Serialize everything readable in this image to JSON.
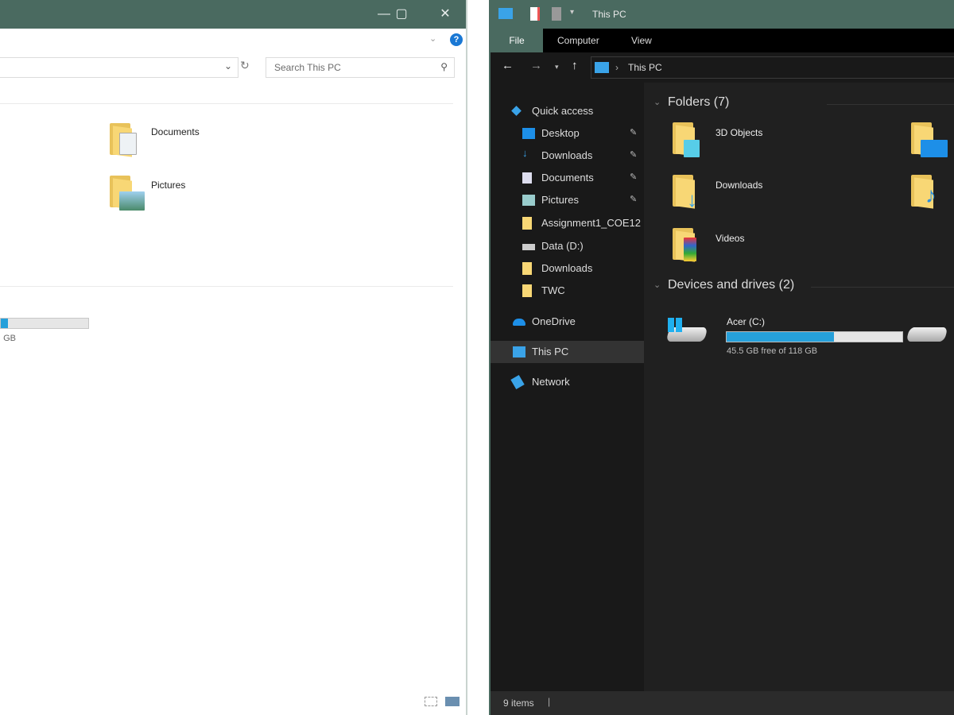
{
  "left_window": {
    "controls": {
      "minimize": "—",
      "maximize": "▢",
      "close": "✕"
    },
    "search_placeholder": "Search This PC",
    "folders": [
      {
        "label": "Documents",
        "icon": "documents-folder-icon"
      },
      {
        "label": "Pictures",
        "icon": "pictures-folder-icon"
      }
    ],
    "drive": {
      "size_text": "GB",
      "used_fraction": 0.08
    },
    "help": "?"
  },
  "right_window": {
    "title": "This PC",
    "tabs": [
      "File",
      "Computer",
      "View"
    ],
    "address": "This PC",
    "sidebar": [
      {
        "label": "Quick access",
        "icon": "star-icon",
        "pinned": false,
        "indent": 0
      },
      {
        "label": "Desktop",
        "icon": "desktop-icon",
        "pinned": true,
        "indent": 1
      },
      {
        "label": "Downloads",
        "icon": "download-icon",
        "pinned": true,
        "indent": 1
      },
      {
        "label": "Documents",
        "icon": "document-icon",
        "pinned": true,
        "indent": 1
      },
      {
        "label": "Pictures",
        "icon": "pictures-icon",
        "pinned": true,
        "indent": 1
      },
      {
        "label": "Assignment1_COE12",
        "icon": "folder-icon",
        "pinned": false,
        "indent": 1
      },
      {
        "label": "Data (D:)",
        "icon": "drive-icon",
        "pinned": false,
        "indent": 1
      },
      {
        "label": "Downloads",
        "icon": "folder-icon",
        "pinned": false,
        "indent": 1
      },
      {
        "label": "TWC",
        "icon": "folder-icon",
        "pinned": false,
        "indent": 1
      },
      {
        "label": "OneDrive",
        "icon": "onedrive-icon",
        "pinned": false,
        "indent": 0
      },
      {
        "label": "This PC",
        "icon": "this-pc-icon",
        "pinned": false,
        "indent": 0,
        "selected": true
      },
      {
        "label": "Network",
        "icon": "network-icon",
        "pinned": false,
        "indent": 0
      }
    ],
    "folders_header": "Folders (7)",
    "folders": [
      {
        "label": "3D Objects"
      },
      {
        "label": "Downloads"
      },
      {
        "label": "Videos"
      }
    ],
    "devices_header": "Devices and drives (2)",
    "drive": {
      "label": "Acer (C:)",
      "size_text": "45.5 GB free of 118 GB",
      "used_fraction": 0.61
    },
    "status": "9 items"
  },
  "colors": {
    "titlebar": "#4a6a60",
    "accent": "#26a0da",
    "folder": "#f8d775"
  }
}
